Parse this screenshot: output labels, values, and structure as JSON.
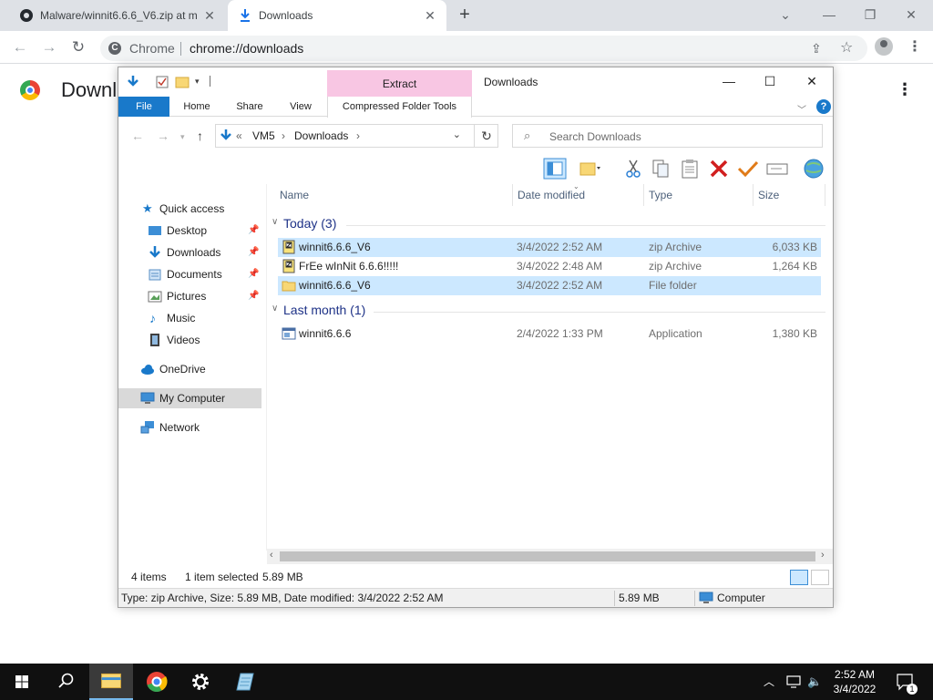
{
  "browser": {
    "tabs": [
      {
        "title": "Malware/winnit6.6.6_V6.zip at m"
      },
      {
        "title": "Downloads"
      }
    ],
    "new_tab": "+",
    "window_controls": {
      "minimize": "⌄",
      "restore": "—",
      "maximize": "❐",
      "close": "✕"
    },
    "omnibox": {
      "site": "Chrome",
      "url": "chrome://downloads"
    },
    "page_title": "Downl"
  },
  "explorer": {
    "title": "Downloads",
    "context_tab": "Extract",
    "ribbon_tabs": [
      "File",
      "Home",
      "Share",
      "View",
      "Compressed Folder Tools"
    ],
    "address": {
      "prefix": "«",
      "crumbs": [
        "VM5",
        "Downloads"
      ]
    },
    "search_placeholder": "Search Downloads",
    "columns": {
      "name": "Name",
      "date": "Date modified",
      "type": "Type",
      "size": "Size"
    },
    "nav": {
      "quick_access": "Quick access",
      "desktop": "Desktop",
      "downloads": "Downloads",
      "documents": "Documents",
      "pictures": "Pictures",
      "music": "Music",
      "videos": "Videos",
      "onedrive": "OneDrive",
      "my_computer": "My Computer",
      "network": "Network"
    },
    "groups": [
      {
        "label": "Today (3)",
        "files": [
          {
            "name": "winnit6.6.6_V6",
            "date": "3/4/2022 2:52 AM",
            "type": "zip Archive",
            "size": "6,033 KB",
            "icon": "zip-icon",
            "selected": true
          },
          {
            "name": "FrEe wInNit 6.6.6!!!!!",
            "date": "3/4/2022 2:48 AM",
            "type": "zip Archive",
            "size": "1,264 KB",
            "icon": "zip-icon",
            "selected": false
          },
          {
            "name": "winnit6.6.6_V6",
            "date": "3/4/2022 2:52 AM",
            "type": "File folder",
            "size": "",
            "icon": "folder-icon",
            "selected": true
          }
        ]
      },
      {
        "label": "Last month (1)",
        "files": [
          {
            "name": "winnit6.6.6",
            "date": "2/4/2022 1:33 PM",
            "type": "Application",
            "size": "1,380 KB",
            "icon": "application-icon",
            "selected": false
          }
        ]
      }
    ],
    "status": {
      "items": "4 items",
      "selection": "1 item selected",
      "selection_size": "5.89 MB",
      "details": "Type: zip Archive, Size: 5.89 MB, Date modified: 3/4/2022 2:52 AM",
      "details_size": "5.89 MB",
      "location": "Computer"
    }
  },
  "taskbar": {
    "time": "2:52 AM",
    "date": "3/4/2022",
    "notifications": "1"
  },
  "colors": {
    "file_tab": "#1979ca",
    "context_tab": "#f8c6e3",
    "selection": "#cce8ff",
    "group_heading": "#1e3287"
  }
}
